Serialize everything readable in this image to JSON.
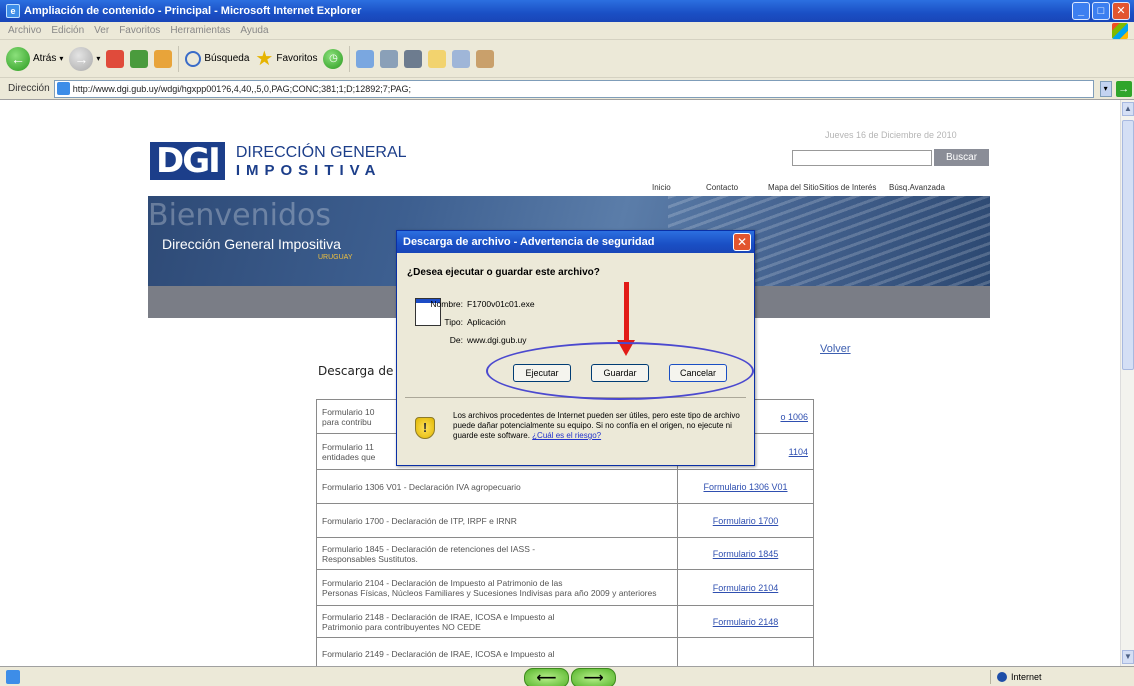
{
  "window": {
    "title": "Ampliación de contenido - Principal - Microsoft Internet Explorer",
    "minimize": "_",
    "maximize": "□",
    "close": "✕"
  },
  "menu": {
    "items": [
      "Archivo",
      "Edición",
      "Ver",
      "Favoritos",
      "Herramientas",
      "Ayuda"
    ]
  },
  "toolbar": {
    "back_label": "Atrás",
    "search_label": "Búsqueda",
    "favorites_label": "Favoritos"
  },
  "address": {
    "label": "Dirección",
    "url": "http://www.dgi.gub.uy/wdgi/hgxpp001?6,4,40,,5,0,PAG;CONC;381;1;D;12892;7;PAG;"
  },
  "site": {
    "date": "Jueves 16 de Diciembre de 2010",
    "search_button": "Buscar",
    "logo_mark": "DGI",
    "logo_line1": "DIRECCIÓN GENERAL",
    "logo_line2": "IMPOSITIVA",
    "nav": [
      "Inicio",
      "Contacto",
      "Mapa del Sitio",
      "Sitios de Interés",
      "Búsq.Avanzada"
    ],
    "banner_welcome": "Bienvenidos",
    "banner_title": "Dirección General Impositiva",
    "banner_country": "URUGUAY",
    "volver": "Volver",
    "section_title": "Descarga de"
  },
  "table": {
    "rows": [
      {
        "desc": "Formulario 10",
        "desc2": "para contribu",
        "link": "o 1006"
      },
      {
        "desc": "Formulario 11",
        "desc2": "entidades que",
        "link": "1104"
      },
      {
        "desc": "Formulario 1306 V01  - Declaración IVA agropecuario",
        "desc2": "",
        "link": "Formulario 1306 V01"
      },
      {
        "desc": "Formulario 1700 - Declaración de ITP, IRPF e IRNR",
        "desc2": "",
        "link": "Formulario 1700"
      },
      {
        "desc": "Formulario 1845 - Declaración de retenciones del IASS -",
        "desc2": "Responsables Sustitutos.",
        "link": "Formulario 1845"
      },
      {
        "desc": "Formulario 2104 - Declaración de Impuesto al Patrimonio de las",
        "desc2": "Personas Físicas, Núcleos Familiares y Sucesiones Indivisas para año 2009 y anteriores",
        "link": "Formulario 2104"
      },
      {
        "desc": "Formulario 2148 - Declaración de IRAE, ICOSA e Impuesto al",
        "desc2": "Patrimonio para contribuyentes NO CEDE",
        "link": "Formulario 2148"
      },
      {
        "desc": "Formulario 2149 - Declaración de IRAE, ICOSA e Impuesto al",
        "desc2": "",
        "link": ""
      }
    ]
  },
  "dialog": {
    "title": "Descarga de archivo - Advertencia de seguridad",
    "question": "¿Desea ejecutar o guardar este archivo?",
    "name_label": "Nombre:",
    "name_value": "F1700v01c01.exe",
    "type_label": "Tipo:",
    "type_value": "Aplicación",
    "from_label": "De:",
    "from_value": "www.dgi.gub.uy",
    "run_button": "Ejecutar",
    "save_button": "Guardar",
    "cancel_button": "Cancelar",
    "warning": "Los archivos procedentes de Internet pueden ser útiles, pero este tipo de archivo puede dañar potencialmente su equipo. Si no confía en el origen, no ejecute ni guarde este software.",
    "risk_link": "¿Cuál es el riesgo?"
  },
  "status": {
    "zone": "Internet"
  },
  "colors": {
    "accent_blue": "#1c3e8a",
    "dialog_title": "#1a4fc4",
    "annotation_arrow": "#e21b17",
    "annotation_ellipse": "#4b49cf"
  }
}
